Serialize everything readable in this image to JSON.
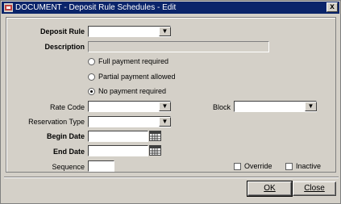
{
  "window": {
    "title": "DOCUMENT - Deposit Rule Schedules - Edit",
    "close_label": "x"
  },
  "form": {
    "deposit_rule": {
      "label": "Deposit Rule",
      "value": ""
    },
    "description": {
      "label": "Description",
      "value": ""
    },
    "payment_options": [
      {
        "label": "Full payment required",
        "selected": false
      },
      {
        "label": "Partial payment allowed",
        "selected": false
      },
      {
        "label": "No payment required",
        "selected": true
      }
    ],
    "rate_code": {
      "label": "Rate Code",
      "value": ""
    },
    "block": {
      "label": "Block",
      "value": ""
    },
    "reservation_type": {
      "label": "Reservation Type",
      "value": ""
    },
    "begin_date": {
      "label": "Begin Date",
      "value": ""
    },
    "end_date": {
      "label": "End Date",
      "value": ""
    },
    "sequence": {
      "label": "Sequence",
      "value": ""
    },
    "override": {
      "label": "Override",
      "checked": false
    },
    "inactive": {
      "label": "Inactive",
      "checked": false
    }
  },
  "buttons": {
    "ok": "OK",
    "close": "Close"
  },
  "icons": {
    "dropdown": "arrow-down-icon",
    "calendar": "calendar-icon"
  }
}
